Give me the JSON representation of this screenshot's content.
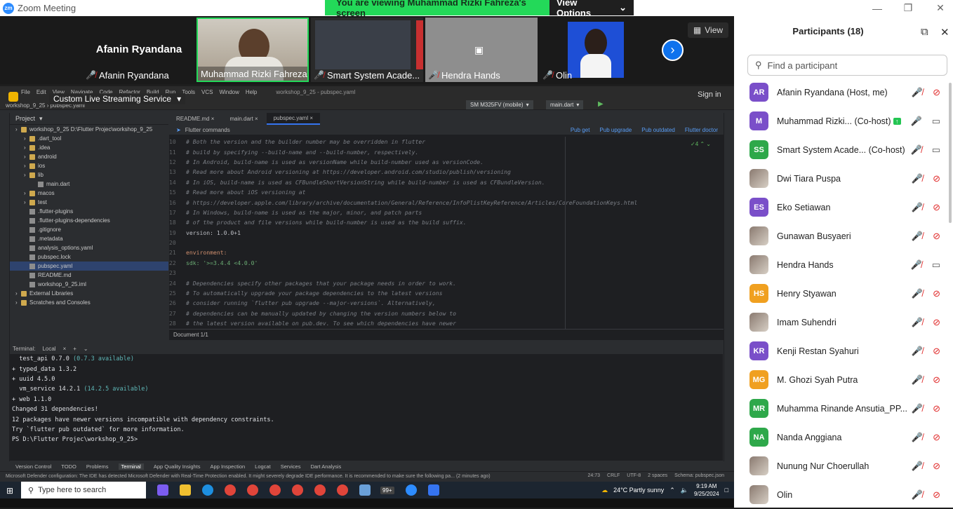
{
  "app": {
    "logo": "zm",
    "title": "Zoom Meeting"
  },
  "banner": {
    "text": "You are viewing Muhammad Rizki Fahreza's screen",
    "options": "View Options",
    "bg": "#23d959"
  },
  "strip": {
    "tiles": [
      {
        "name": "Afanin Ryandana",
        "big_name": "Afanin Ryandana",
        "muted": true
      },
      {
        "name": "Muhammad Rizki Fahreza",
        "muted": false
      },
      {
        "name": "Smart System Acade...",
        "muted": true
      },
      {
        "name": "Hendra Hands",
        "muted": true
      },
      {
        "name": "Olin",
        "muted": true
      }
    ],
    "view_label": "View"
  },
  "ide": {
    "menu": [
      "File",
      "Edit",
      "View",
      "Navigate",
      "Code",
      "Refactor",
      "Build",
      "Run",
      "Tools",
      "VCS",
      "Window",
      "Help"
    ],
    "window_title": "workshop_9_25 - pubspec.yaml",
    "sign_in": "Sign in",
    "device": "SM M325FV (mobile)",
    "run_config": "main.dart",
    "breadcrumb": "workshop_9_25",
    "breadcrumb_file": "pubspec.yaml",
    "cls_label": "Custom Live Streaming Service",
    "project_label": "Project",
    "tree": [
      {
        "label": "workshop_9_25  D:\\Flutter Projec\\workshop_9_25",
        "indent": 0,
        "type": "folder"
      },
      {
        "label": ".dart_tool",
        "indent": 1,
        "type": "folder"
      },
      {
        "label": ".idea",
        "indent": 1,
        "type": "folder"
      },
      {
        "label": "android",
        "indent": 1,
        "type": "folder"
      },
      {
        "label": "ios",
        "indent": 1,
        "type": "folder"
      },
      {
        "label": "lib",
        "indent": 1,
        "type": "folder"
      },
      {
        "label": "main.dart",
        "indent": 2,
        "type": "file"
      },
      {
        "label": "macos",
        "indent": 1,
        "type": "folder"
      },
      {
        "label": "test",
        "indent": 1,
        "type": "folder"
      },
      {
        "label": ".flutter-plugins",
        "indent": 1,
        "type": "file"
      },
      {
        "label": ".flutter-plugins-dependencies",
        "indent": 1,
        "type": "file"
      },
      {
        "label": ".gitignore",
        "indent": 1,
        "type": "file"
      },
      {
        "label": ".metadata",
        "indent": 1,
        "type": "file"
      },
      {
        "label": "analysis_options.yaml",
        "indent": 1,
        "type": "file"
      },
      {
        "label": "pubspec.lock",
        "indent": 1,
        "type": "file"
      },
      {
        "label": "pubspec.yaml",
        "indent": 1,
        "type": "file",
        "selected": true
      },
      {
        "label": "README.md",
        "indent": 1,
        "type": "file"
      },
      {
        "label": "workshop_9_25.iml",
        "indent": 1,
        "type": "file"
      },
      {
        "label": "External Libraries",
        "indent": 0,
        "type": "folder"
      },
      {
        "label": "Scratches and Consoles",
        "indent": 0,
        "type": "folder"
      }
    ],
    "tabs": [
      "README.md",
      "main.dart",
      "pubspec.yaml"
    ],
    "active_tab": 2,
    "flutter_commands": "Flutter commands",
    "flutter_links": [
      "Pub get",
      "Pub upgrade",
      "Pub outdated",
      "Flutter doctor"
    ],
    "code": [
      {
        "n": "10",
        "t": "# Both the version and the builder number may be overridden in flutter",
        "k": "cm"
      },
      {
        "n": "11",
        "t": "# build by specifying --build-name and --build-number, respectively.",
        "k": "cm"
      },
      {
        "n": "12",
        "t": "# In Android, build-name is used as versionName while build-number used as versionCode.",
        "k": "cm"
      },
      {
        "n": "13",
        "t": "# Read more about Android versioning at https://developer.android.com/studio/publish/versioning",
        "k": "cm"
      },
      {
        "n": "14",
        "t": "# In iOS, build-name is used as CFBundleShortVersionString while build-number is used as CFBundleVersion.",
        "k": "cm"
      },
      {
        "n": "15",
        "t": "# Read more about iOS versioning at",
        "k": "cm"
      },
      {
        "n": "16",
        "t": "# https://developer.apple.com/library/archive/documentation/General/Reference/InfoPlistKeyReference/Articles/CoreFoundationKeys.html",
        "k": "lk"
      },
      {
        "n": "17",
        "t": "# In Windows, build-name is used as the major, minor, and patch parts",
        "k": "cm"
      },
      {
        "n": "18",
        "t": "# of the product and file versions while build-number is used as the build suffix.",
        "k": "cm"
      },
      {
        "n": "19",
        "t": "version: 1.0.0+1",
        "k": "kv"
      },
      {
        "n": "20",
        "t": "",
        "k": "cm"
      },
      {
        "n": "21",
        "t": "environment:",
        "k": "ky"
      },
      {
        "n": "22",
        "t": "  sdk: '>=3.4.4 <4.0.0'",
        "k": "sdk"
      },
      {
        "n": "23",
        "t": "",
        "k": "cm"
      },
      {
        "n": "24",
        "t": "# Dependencies specify other packages that your package needs in order to work.",
        "k": "cm"
      },
      {
        "n": "25",
        "t": "# To automatically upgrade your package dependencies to the latest versions",
        "k": "cm"
      },
      {
        "n": "26",
        "t": "# consider running `flutter pub upgrade --major-versions`. Alternatively,",
        "k": "cm"
      },
      {
        "n": "27",
        "t": "# dependencies can be manually updated by changing the version numbers below to",
        "k": "cm"
      },
      {
        "n": "28",
        "t": "# the latest version available on pub.dev. To see which dependencies have newer",
        "k": "cm"
      }
    ],
    "warn_count": "4",
    "document": "Document 1/1",
    "terminal": {
      "label": "Terminal:",
      "tab": "Local",
      "lines": [
        {
          "pre": "  test_api 0.7.0 ",
          "extra": "(0.7.3 available)"
        },
        {
          "pre": "+ typed_data 1.3.2",
          "extra": ""
        },
        {
          "pre": "+ uuid 4.5.0",
          "extra": ""
        },
        {
          "pre": "  vm_service 14.2.1 ",
          "extra": "(14.2.5 available)"
        },
        {
          "pre": "+ web 1.1.0",
          "extra": ""
        },
        {
          "pre": "Changed 31 dependencies!",
          "extra": ""
        },
        {
          "pre": "12 packages have newer versions incompatible with dependency constraints.",
          "extra": ""
        },
        {
          "pre": "Try `flutter pub outdated` for more information.",
          "extra": ""
        },
        {
          "pre": "PS D:\\Flutter Projec\\workshop_9_25> ",
          "extra": ""
        }
      ]
    },
    "tool_tabs": [
      "Version Control",
      "TODO",
      "Problems",
      "Terminal",
      "App Quality Insights",
      "App Inspection",
      "Logcat",
      "Services",
      "Dart Analysis"
    ],
    "active_tool": 3,
    "status_msg": "Microsoft Defender configuration: The IDE has detected Microsoft Defender with Real-Time Protection enabled. It might severely degrade IDE performance. It is recommended to make sure the following pa... (2 minutes ago)",
    "status_right": [
      "24:73",
      "CRLF",
      "UTF-8",
      "2 spaces",
      "Schema: pubspec.json"
    ]
  },
  "taskbar": {
    "search_placeholder": "Type here to search",
    "weather": "24°C  Partly sunny",
    "time": "9:19 AM",
    "date": "9/25/2024",
    "badge": "99+"
  },
  "panel": {
    "title": "Participants (18)",
    "search_placeholder": "Find a participant",
    "participants": [
      {
        "name": "Afanin Ryandana (Host, me)",
        "initials": "AR",
        "color": "#7a4fc9",
        "mic": "off",
        "cam": "off"
      },
      {
        "name": "Muhammad Rizki... (Co-host)",
        "initials": "M",
        "color": "#7a4fc9",
        "mic": "on",
        "cam": "on",
        "sharing": true
      },
      {
        "name": "Smart System Acade...  (Co-host)",
        "initials": "SS",
        "color": "#2ea84a",
        "mic": "off",
        "cam": "on"
      },
      {
        "name": "Dwi Tiara Puspa",
        "initials": "",
        "color": "",
        "mic": "off",
        "cam": "off",
        "photo": true
      },
      {
        "name": "Eko Setiawan",
        "initials": "ES",
        "color": "#7a4fc9",
        "mic": "off",
        "cam": "off"
      },
      {
        "name": "Gunawan Busyaeri",
        "initials": "",
        "color": "",
        "mic": "off",
        "cam": "off",
        "photo": true
      },
      {
        "name": "Hendra Hands",
        "initials": "",
        "color": "",
        "mic": "off",
        "cam": "on",
        "photo": true
      },
      {
        "name": "Henry Styawan",
        "initials": "HS",
        "color": "#f0a020",
        "mic": "off",
        "cam": "off"
      },
      {
        "name": "Imam Suhendri",
        "initials": "",
        "color": "",
        "mic": "off",
        "cam": "off",
        "photo": true
      },
      {
        "name": "Kenji Restan Syahuri",
        "initials": "KR",
        "color": "#7a4fc9",
        "mic": "off",
        "cam": "off"
      },
      {
        "name": "M. Ghozi Syah Putra",
        "initials": "MG",
        "color": "#f0a020",
        "mic": "off",
        "cam": "off"
      },
      {
        "name": "Muhamma Rinande Ansutia_PP...",
        "initials": "MR",
        "color": "#2ea84a",
        "mic": "off",
        "cam": "off"
      },
      {
        "name": "Nanda  Anggiana",
        "initials": "NA",
        "color": "#2ea84a",
        "mic": "off",
        "cam": "off"
      },
      {
        "name": "Nunung Nur Choerullah",
        "initials": "",
        "color": "",
        "mic": "off",
        "cam": "off",
        "photo": true
      },
      {
        "name": "Olin",
        "initials": "",
        "color": "",
        "mic": "off",
        "cam": "off",
        "photo": true
      }
    ]
  }
}
